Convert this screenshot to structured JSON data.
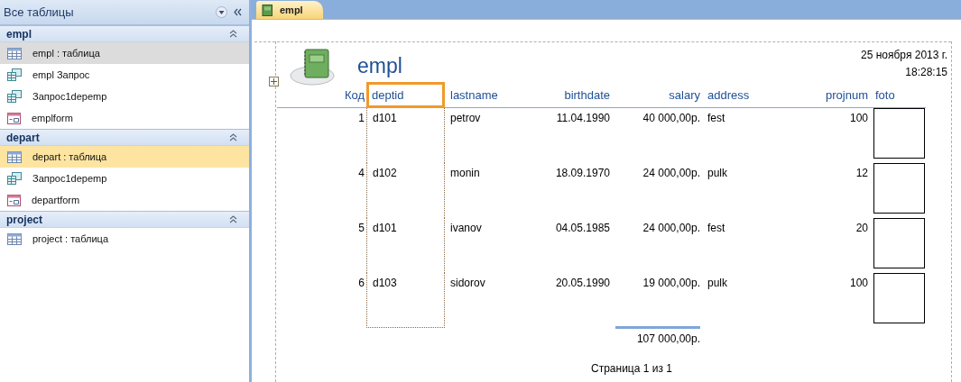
{
  "navigation": {
    "title": "Все таблицы",
    "groups": [
      {
        "name": "empl",
        "expanded": true,
        "items": [
          {
            "kind": "table",
            "label": "empl : таблица",
            "selected": false,
            "hovered": true
          },
          {
            "kind": "query",
            "label": "empl Запрос",
            "selected": false,
            "hovered": false
          },
          {
            "kind": "query",
            "label": "Запрос1depemp",
            "selected": false,
            "hovered": false
          },
          {
            "kind": "form",
            "label": "emplform",
            "selected": false,
            "hovered": false
          }
        ]
      },
      {
        "name": "depart",
        "expanded": true,
        "items": [
          {
            "kind": "table",
            "label": "depart : таблица",
            "selected": true,
            "hovered": false
          },
          {
            "kind": "query",
            "label": "Запрос1depemp",
            "selected": false,
            "hovered": false
          },
          {
            "kind": "form",
            "label": "departform",
            "selected": false,
            "hovered": false
          }
        ]
      },
      {
        "name": "project",
        "expanded": true,
        "items": [
          {
            "kind": "table",
            "label": "project : таблица",
            "selected": false,
            "hovered": false
          }
        ]
      }
    ]
  },
  "document_tab": {
    "label": "empl",
    "selected": true
  },
  "report": {
    "title": "empl",
    "date": "25 ноября 2013 г.",
    "time": "18:28:15",
    "columns": [
      {
        "kind": "number",
        "label": "Код",
        "selected": false
      },
      {
        "kind": "text",
        "label": "deptid",
        "selected": true
      },
      {
        "kind": "text",
        "label": "lastname",
        "selected": false
      },
      {
        "kind": "number",
        "label": "birthdate",
        "selected": false
      },
      {
        "kind": "number",
        "label": "salary",
        "selected": false
      },
      {
        "kind": "text",
        "label": "address",
        "selected": false
      },
      {
        "kind": "number",
        "label": "projnum",
        "selected": false
      },
      {
        "kind": "photo",
        "label": "foto",
        "selected": false
      }
    ],
    "rows": [
      {
        "cells": [
          "1",
          "d101",
          "petrov",
          "11.04.1990",
          "40 000,00р.",
          "fest",
          "100"
        ]
      },
      {
        "cells": [
          "4",
          "d102",
          "monin",
          "18.09.1970",
          "24 000,00р.",
          "pulk",
          "12"
        ]
      },
      {
        "cells": [
          "5",
          "d101",
          "ivanov",
          "04.05.1985",
          "24 000,00р.",
          "fest",
          "20"
        ]
      },
      {
        "cells": [
          "6",
          "d103",
          "sidorov",
          "20.05.1990",
          "19 000,00р.",
          "pulk",
          "100"
        ]
      }
    ],
    "total": "107 000,00р.",
    "page_number": "Страница 1 из 1"
  }
}
